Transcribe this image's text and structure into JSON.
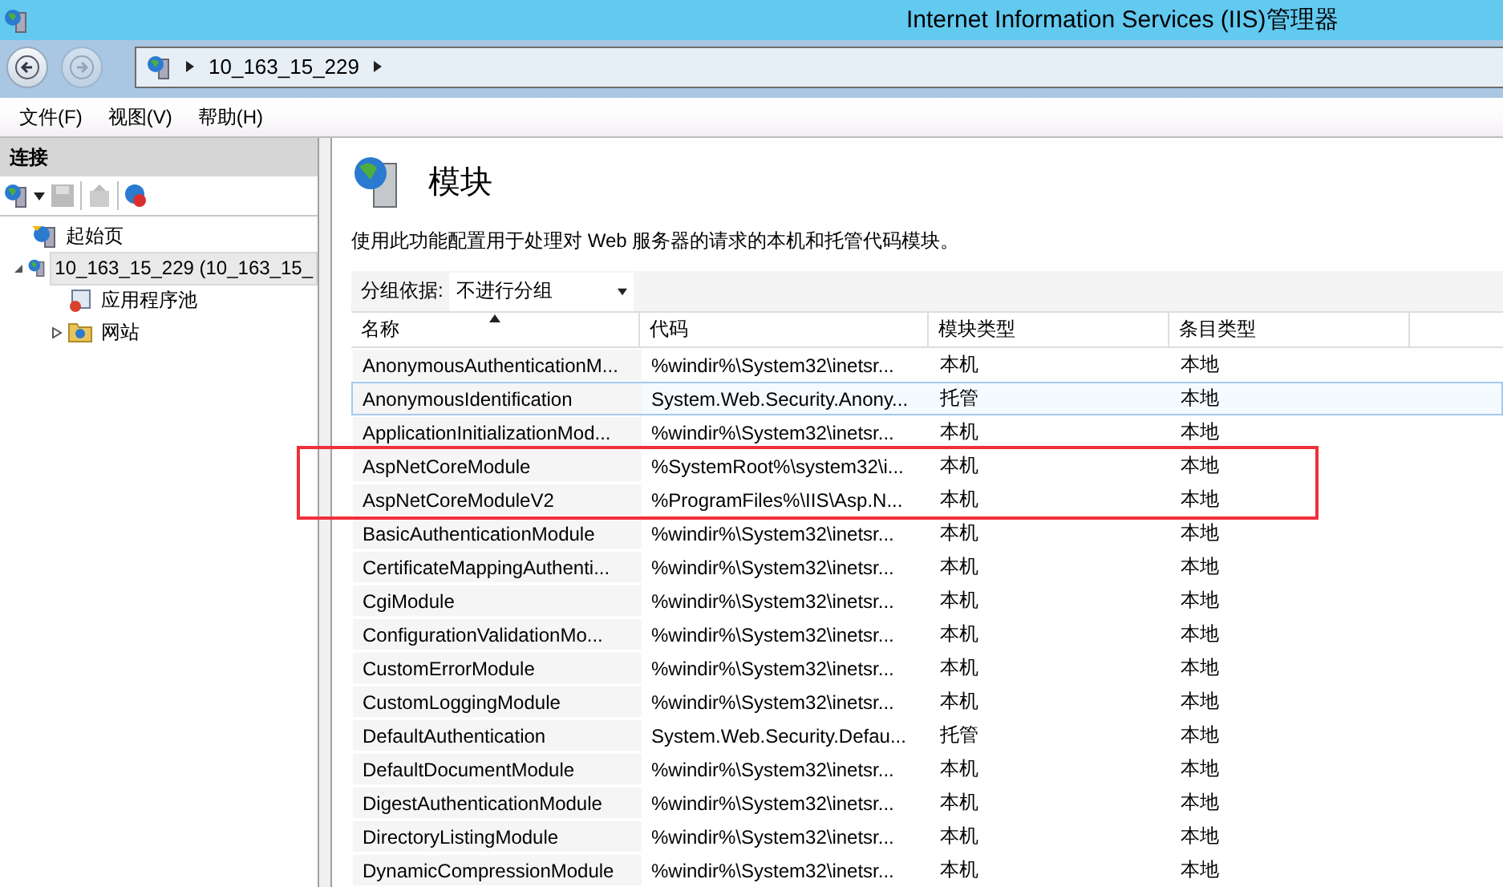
{
  "window": {
    "title": "Internet Information Services (IIS)管理器"
  },
  "address_bar": {
    "segments": [
      "10_163_15_229"
    ]
  },
  "menu": [
    "文件(F)",
    "视图(V)",
    "帮助(H)"
  ],
  "connections": {
    "title": "连接",
    "tree": [
      {
        "label": "起始页",
        "kind": "start",
        "selected": false
      },
      {
        "label": "10_163_15_229 (10_163_15_",
        "kind": "server",
        "selected": true,
        "expanded": true,
        "children": [
          {
            "label": "应用程序池",
            "kind": "pool",
            "selected": false
          },
          {
            "label": "网站",
            "kind": "sites",
            "selected": false,
            "expanded": false
          }
        ]
      }
    ]
  },
  "page": {
    "title": "模块",
    "description": "使用此功能配置用于处理对 Web 服务器的请求的本机和托管代码模块。",
    "group_by": {
      "label": "分组依据:",
      "value": "不进行分组"
    }
  },
  "table": {
    "columns": [
      {
        "label": "名称",
        "sorted": true
      },
      {
        "label": "代码",
        "sorted": false
      },
      {
        "label": "模块类型",
        "sorted": false
      },
      {
        "label": "条目类型",
        "sorted": false
      }
    ],
    "rows": [
      {
        "cells": [
          "AnonymousAuthenticationM...",
          "%windir%\\System32\\inetsr...",
          "本机",
          "本地"
        ],
        "hovered": false,
        "highlighted": false
      },
      {
        "cells": [
          "AnonymousIdentification",
          "System.Web.Security.Anony...",
          "托管",
          "本地"
        ],
        "hovered": true,
        "highlighted": false
      },
      {
        "cells": [
          "ApplicationInitializationMod...",
          "%windir%\\System32\\inetsr...",
          "本机",
          "本地"
        ],
        "hovered": false,
        "highlighted": false
      },
      {
        "cells": [
          "AspNetCoreModule",
          "%SystemRoot%\\system32\\i...",
          "本机",
          "本地"
        ],
        "hovered": false,
        "highlighted": true
      },
      {
        "cells": [
          "AspNetCoreModuleV2",
          "%ProgramFiles%\\IIS\\Asp.N...",
          "本机",
          "本地"
        ],
        "hovered": false,
        "highlighted": true
      },
      {
        "cells": [
          "BasicAuthenticationModule",
          "%windir%\\System32\\inetsr...",
          "本机",
          "本地"
        ],
        "hovered": false,
        "highlighted": false
      },
      {
        "cells": [
          "CertificateMappingAuthenti...",
          "%windir%\\System32\\inetsr...",
          "本机",
          "本地"
        ],
        "hovered": false,
        "highlighted": false
      },
      {
        "cells": [
          "CgiModule",
          "%windir%\\System32\\inetsr...",
          "本机",
          "本地"
        ],
        "hovered": false,
        "highlighted": false
      },
      {
        "cells": [
          "ConfigurationValidationMo...",
          "%windir%\\System32\\inetsr...",
          "本机",
          "本地"
        ],
        "hovered": false,
        "highlighted": false
      },
      {
        "cells": [
          "CustomErrorModule",
          "%windir%\\System32\\inetsr...",
          "本机",
          "本地"
        ],
        "hovered": false,
        "highlighted": false
      },
      {
        "cells": [
          "CustomLoggingModule",
          "%windir%\\System32\\inetsr...",
          "本机",
          "本地"
        ],
        "hovered": false,
        "highlighted": false
      },
      {
        "cells": [
          "DefaultAuthentication",
          "System.Web.Security.Defau...",
          "托管",
          "本地"
        ],
        "hovered": false,
        "highlighted": false
      },
      {
        "cells": [
          "DefaultDocumentModule",
          "%windir%\\System32\\inetsr...",
          "本机",
          "本地"
        ],
        "hovered": false,
        "highlighted": false
      },
      {
        "cells": [
          "DigestAuthenticationModule",
          "%windir%\\System32\\inetsr...",
          "本机",
          "本地"
        ],
        "hovered": false,
        "highlighted": false
      },
      {
        "cells": [
          "DirectoryListingModule",
          "%windir%\\System32\\inetsr...",
          "本机",
          "本地"
        ],
        "hovered": false,
        "highlighted": false
      },
      {
        "cells": [
          "DynamicCompressionModule",
          "%windir%\\System32\\inetsr...",
          "本机",
          "本地"
        ],
        "hovered": false,
        "highlighted": false
      }
    ]
  }
}
